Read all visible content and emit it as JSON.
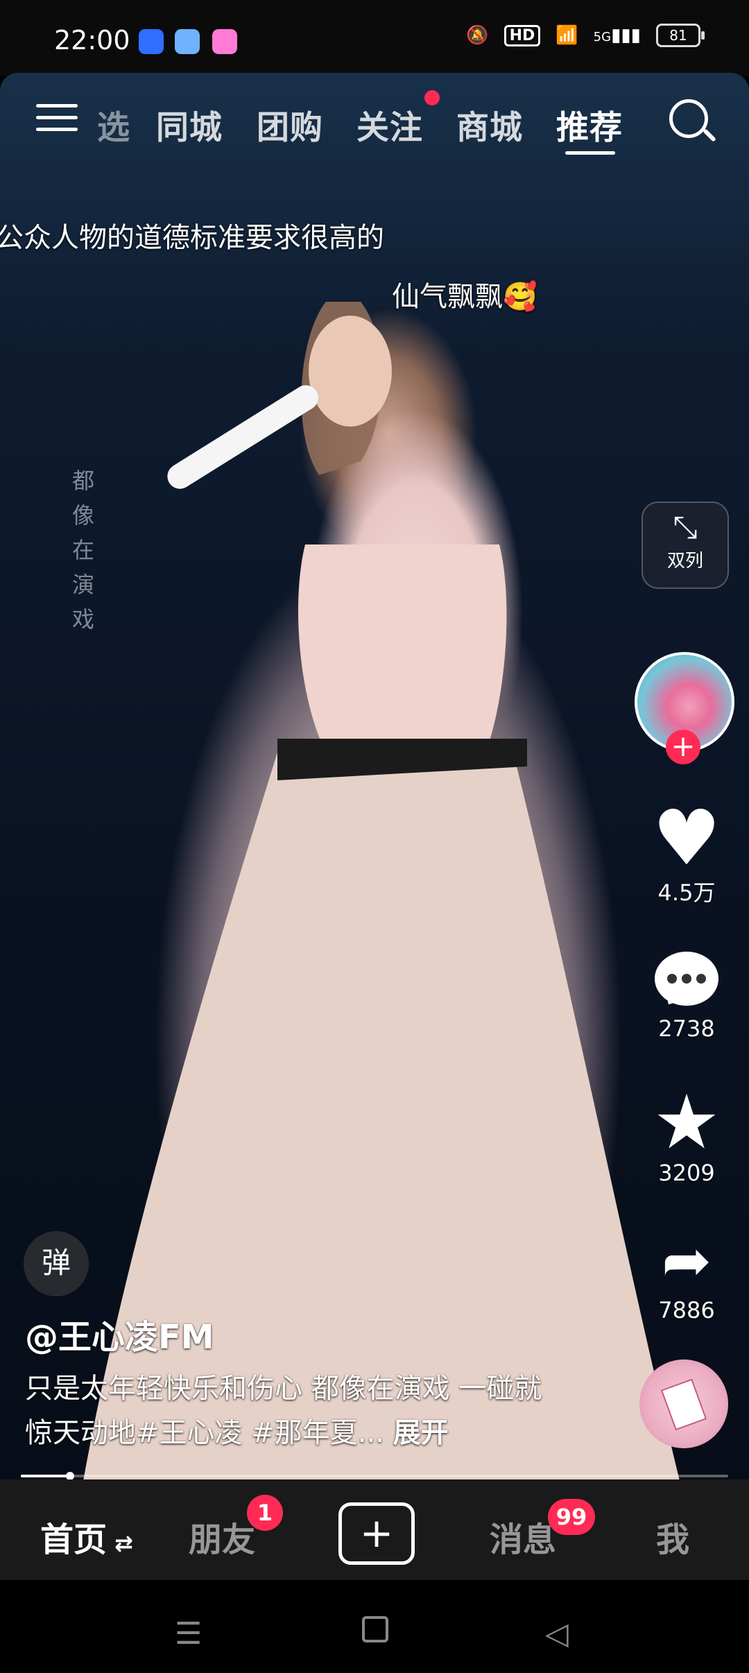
{
  "status_bar": {
    "time": "22:00",
    "hd_label": "HD",
    "network_label": "5G",
    "battery": "81",
    "icons": [
      "notification-muted-icon",
      "wifi-icon",
      "signal-icon"
    ]
  },
  "top_tabs": {
    "partial_tab": "选",
    "tabs": [
      "同城",
      "团购",
      "关注",
      "商城",
      "推荐"
    ],
    "active": "推荐"
  },
  "overlay": {
    "danmu_1": "公众人物的道德标准要求很高的",
    "danmu_2": "仙气飘飘🥰",
    "vertical_text": "都像在演戏"
  },
  "side_actions": {
    "dual_column_label": "双列",
    "likes": "4.5万",
    "comments": "2738",
    "favorites": "3209",
    "shares": "7886"
  },
  "post": {
    "danmaku_button": "弹",
    "author": "@王心凌FM",
    "description": "只是太年轻快乐和伤心 都像在演戏 一碰就惊天动地#王心凌 #那年夏...",
    "expand": "展开",
    "progress": 0.07
  },
  "bottom_nav": {
    "home": "首页",
    "friends": "朋友",
    "friends_badge": "1",
    "messages": "消息",
    "messages_badge": "99",
    "me": "我"
  },
  "colors": {
    "accent": "#ff2b55",
    "nav_bg": "#1a1a1a"
  }
}
